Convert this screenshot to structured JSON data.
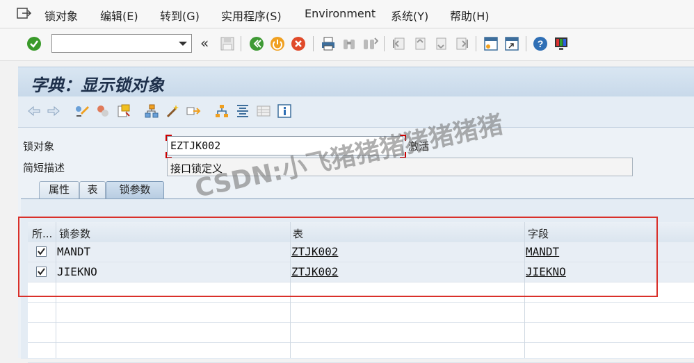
{
  "menubar": {
    "items": [
      "锁对象",
      "编辑(E)",
      "转到(G)",
      "实用程序(S)",
      "Environment",
      "系统(Y)",
      "帮助(H)"
    ]
  },
  "toolbar": {
    "command_value": "",
    "icons": [
      "enter-icon",
      "back-icon",
      "exit-icon",
      "cancel-icon",
      "print-icon",
      "find-icon",
      "find-next-icon",
      "first-page-icon",
      "prev-page-icon",
      "next-page-icon",
      "last-page-icon",
      "new-session-icon",
      "shortcut-icon",
      "help-icon",
      "customize-icon"
    ]
  },
  "title": "字典：显示锁对象",
  "form": {
    "lock_object_label": "锁对象",
    "lock_object_value": "EZTJK002",
    "status": "激活",
    "short_desc_label": "简短描述",
    "short_desc_value": "接口锁定义"
  },
  "tabs": [
    {
      "label": "属性",
      "active": false
    },
    {
      "label": "表",
      "active": false
    },
    {
      "label": "锁参数",
      "active": true
    }
  ],
  "table": {
    "headers": [
      "所...",
      "锁参数",
      "表",
      "字段"
    ],
    "rows": [
      {
        "checked": true,
        "param": "MANDT",
        "table": "ZTJK002",
        "field": "MANDT"
      },
      {
        "checked": true,
        "param": "JIEKNO",
        "table": "ZTJK002",
        "field": "JIEKNO"
      }
    ]
  },
  "watermark": "CSDN:小飞猪猪猪猪猪猪猪",
  "colors": {
    "title_band": "#c8d9ea",
    "highlight_border": "#d9302a",
    "enter_green": "#3a9a2a"
  }
}
